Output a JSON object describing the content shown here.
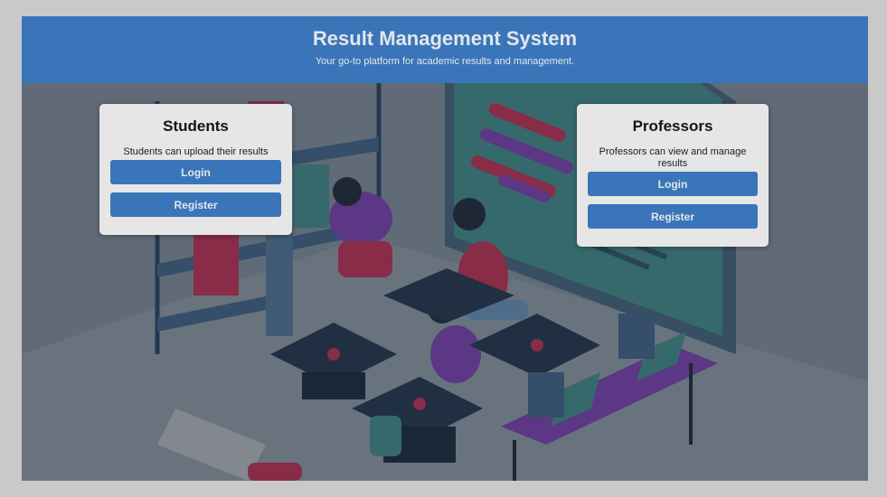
{
  "header": {
    "title": "Result Management System",
    "subtitle": "Your go-to platform for academic results and management."
  },
  "students": {
    "title": "Students",
    "description": "Students can upload their results",
    "login_label": "Login",
    "register_label": "Register"
  },
  "professors": {
    "title": "Professors",
    "description": "Professors can view and manage results",
    "login_label": "Login",
    "register_label": "Register"
  },
  "colors": {
    "accent": "#3a75b9",
    "page_background": "#c9c9c9",
    "card_background": "#e6e6e6"
  },
  "icons": [
    "classroom-illustration"
  ]
}
